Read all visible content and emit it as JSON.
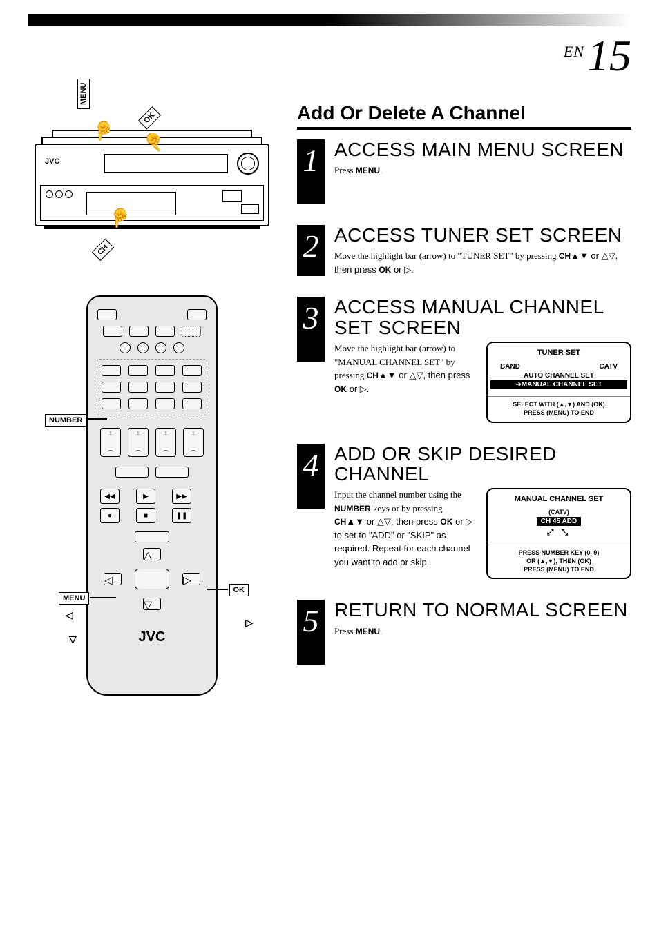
{
  "page": {
    "lang": "EN",
    "number": "15"
  },
  "section_title": "Add Or Delete A Channel",
  "vcr": {
    "logo": "JVC",
    "callouts": {
      "menu": "MENU",
      "ok": "OK",
      "ch": "CH"
    }
  },
  "remote": {
    "logo": "JVC",
    "callouts": {
      "number": "NUMBER",
      "menu": "MENU",
      "ok": "OK"
    },
    "triangles": {
      "left": "◁",
      "down": "▽",
      "right": "▷"
    }
  },
  "steps": [
    {
      "num": "1",
      "title": "ACCESS MAIN MENU SCREEN",
      "text_parts": [
        "Press ",
        "MENU",
        "."
      ]
    },
    {
      "num": "2",
      "title": "ACCESS TUNER SET SCREEN",
      "text_parts": [
        "Move the highlight bar (arrow) to \"TUNER SET\" by pressing ",
        "CH",
        "▲▼ or △▽, then press ",
        "OK",
        " or ▷."
      ]
    },
    {
      "num": "3",
      "title": "ACCESS MANUAL CHANNEL SET SCREEN",
      "text_parts": [
        "Move the highlight bar (arrow) to \"MANUAL CHANNEL SET\" by pressing ",
        "CH",
        "▲▼ or △▽, then press ",
        "OK",
        " or ▷."
      ],
      "osd": {
        "title": "TUNER SET",
        "rows": [
          {
            "left": "BAND",
            "right": "CATV"
          },
          {
            "left": "AUTO CHANNEL SET",
            "right": ""
          }
        ],
        "highlight": "MANUAL CHANNEL SET",
        "arrow": "➔",
        "instr1": "SELECT WITH (▲,▼) AND (OK)",
        "instr2": "PRESS (MENU) TO END"
      }
    },
    {
      "num": "4",
      "title": "ADD OR SKIP DESIRED CHANNEL",
      "text_parts": [
        "Input the channel number using the ",
        "NUMBER",
        " keys or by pressing ",
        "CH",
        "▲▼ or △▽, then press ",
        "OK",
        " or ▷ to set to \"ADD\" or \"SKIP\" as required. Repeat for each channel you want to add or skip."
      ],
      "osd": {
        "title": "MANUAL CHANNEL SET",
        "catv": "(CATV)",
        "ch_line": "CH    45  ADD",
        "arrows": "⤢   ⤡",
        "instr1": "PRESS NUMBER KEY (0–9)",
        "instr2": "OR (▲,▼), THEN (OK)",
        "instr3": "PRESS (MENU) TO END"
      }
    },
    {
      "num": "5",
      "title": "RETURN TO NORMAL SCREEN",
      "text_parts": [
        "Press ",
        "MENU",
        "."
      ]
    }
  ]
}
